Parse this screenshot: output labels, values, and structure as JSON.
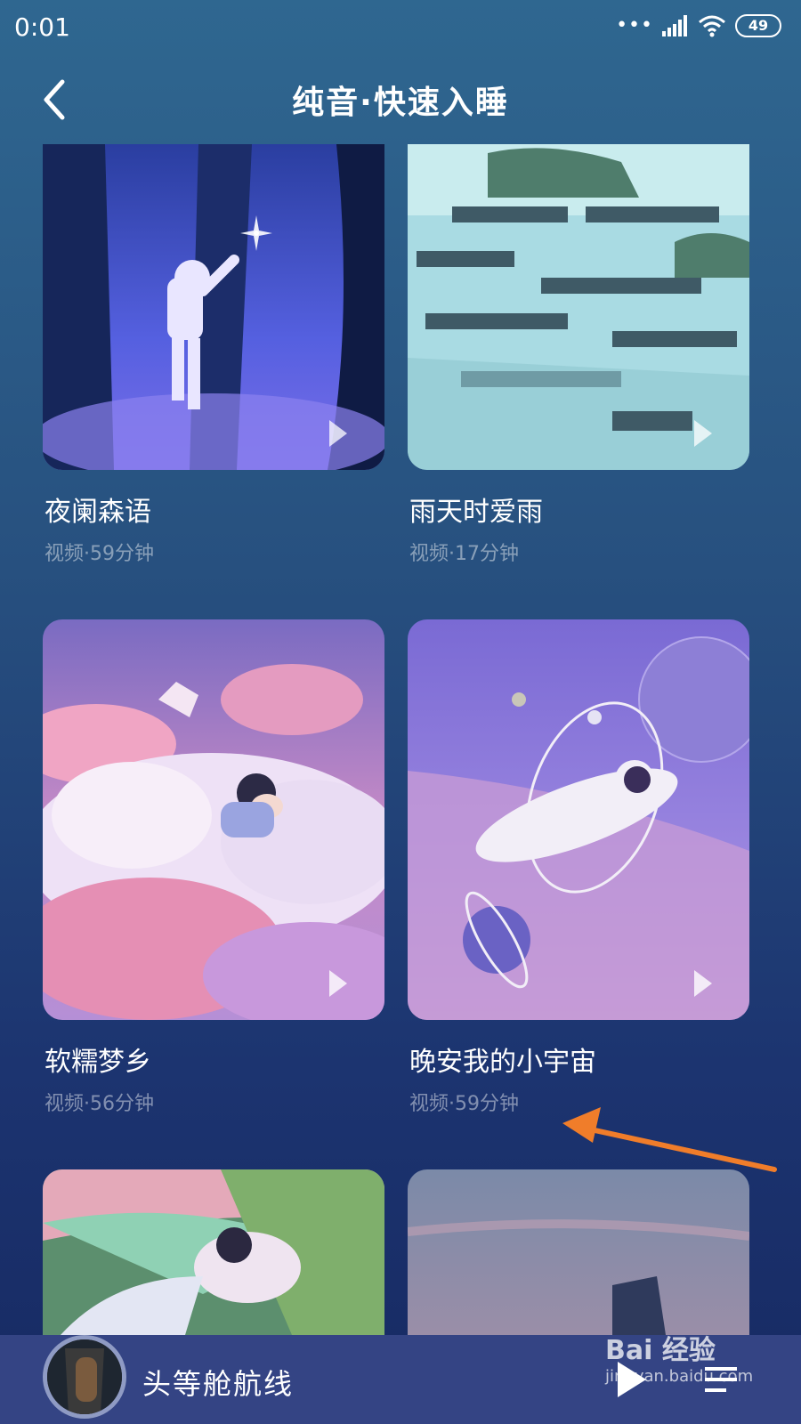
{
  "status_bar": {
    "time": "0:01",
    "battery": "49"
  },
  "header": {
    "title": "纯音·快速入睡"
  },
  "cards": [
    {
      "title": "夜阑森语",
      "meta": "视频·59分钟"
    },
    {
      "title": "雨天时爱雨",
      "meta": "视频·17分钟"
    },
    {
      "title": "软糯梦乡",
      "meta": "视频·56分钟"
    },
    {
      "title": "晚安我的小宇宙",
      "meta": "视频·59分钟"
    }
  ],
  "player": {
    "title": "头等舱航线"
  },
  "watermark": {
    "line1": "Bai 经验",
    "line2": "jingyan.baidu.com"
  },
  "colors": {
    "accent": "#f07d2a",
    "background_top": "#2f6790",
    "background_bottom": "#172a63"
  }
}
